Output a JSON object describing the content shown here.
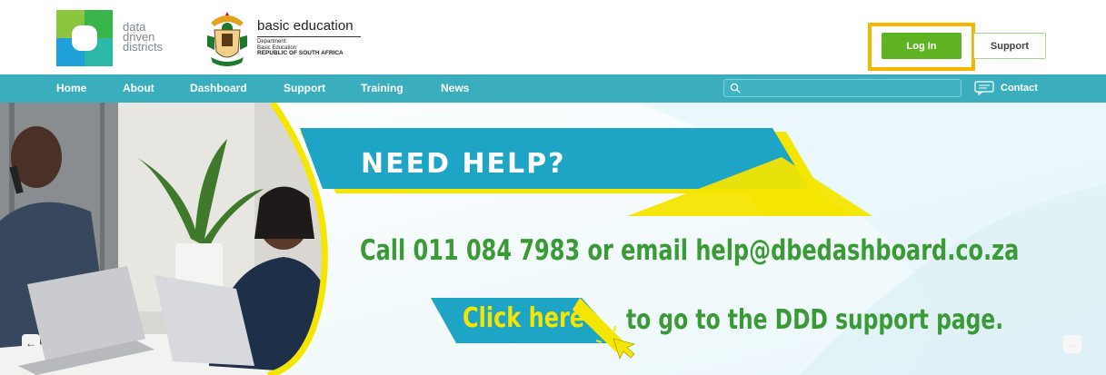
{
  "header": {
    "logo_lines": [
      "data",
      "driven",
      "districts"
    ],
    "dbe_title": "basic education",
    "dbe_sub": [
      "Department:",
      "Basic Education",
      "REPUBLIC OF SOUTH AFRICA"
    ],
    "login_label": "Log In",
    "support_label": "Support"
  },
  "nav": {
    "items": [
      {
        "label": "Home"
      },
      {
        "label": "About"
      },
      {
        "label": "Dashboard"
      },
      {
        "label": "Support"
      },
      {
        "label": "Training"
      },
      {
        "label": "News"
      }
    ],
    "search_placeholder": "",
    "contact_label": "Contact"
  },
  "banner": {
    "headline": "NEED HELP?",
    "call_text": "Call 011 084 7983 or email help@dbedashboard.co.za",
    "click_label": "Click here",
    "support_text": "to go to the DDD support page."
  },
  "icons": {
    "search": "search-icon",
    "contact": "chat-icon",
    "prev": "arrow-left-icon",
    "next": "arrow-right-icon"
  },
  "colors": {
    "nav_bg": "#3aaebd",
    "login_bg": "#5fb323",
    "highlight_frame": "#f7b500",
    "banner_teal": "#1ea4c4",
    "banner_yellow": "#f4e600",
    "text_green": "#3a9a36"
  }
}
